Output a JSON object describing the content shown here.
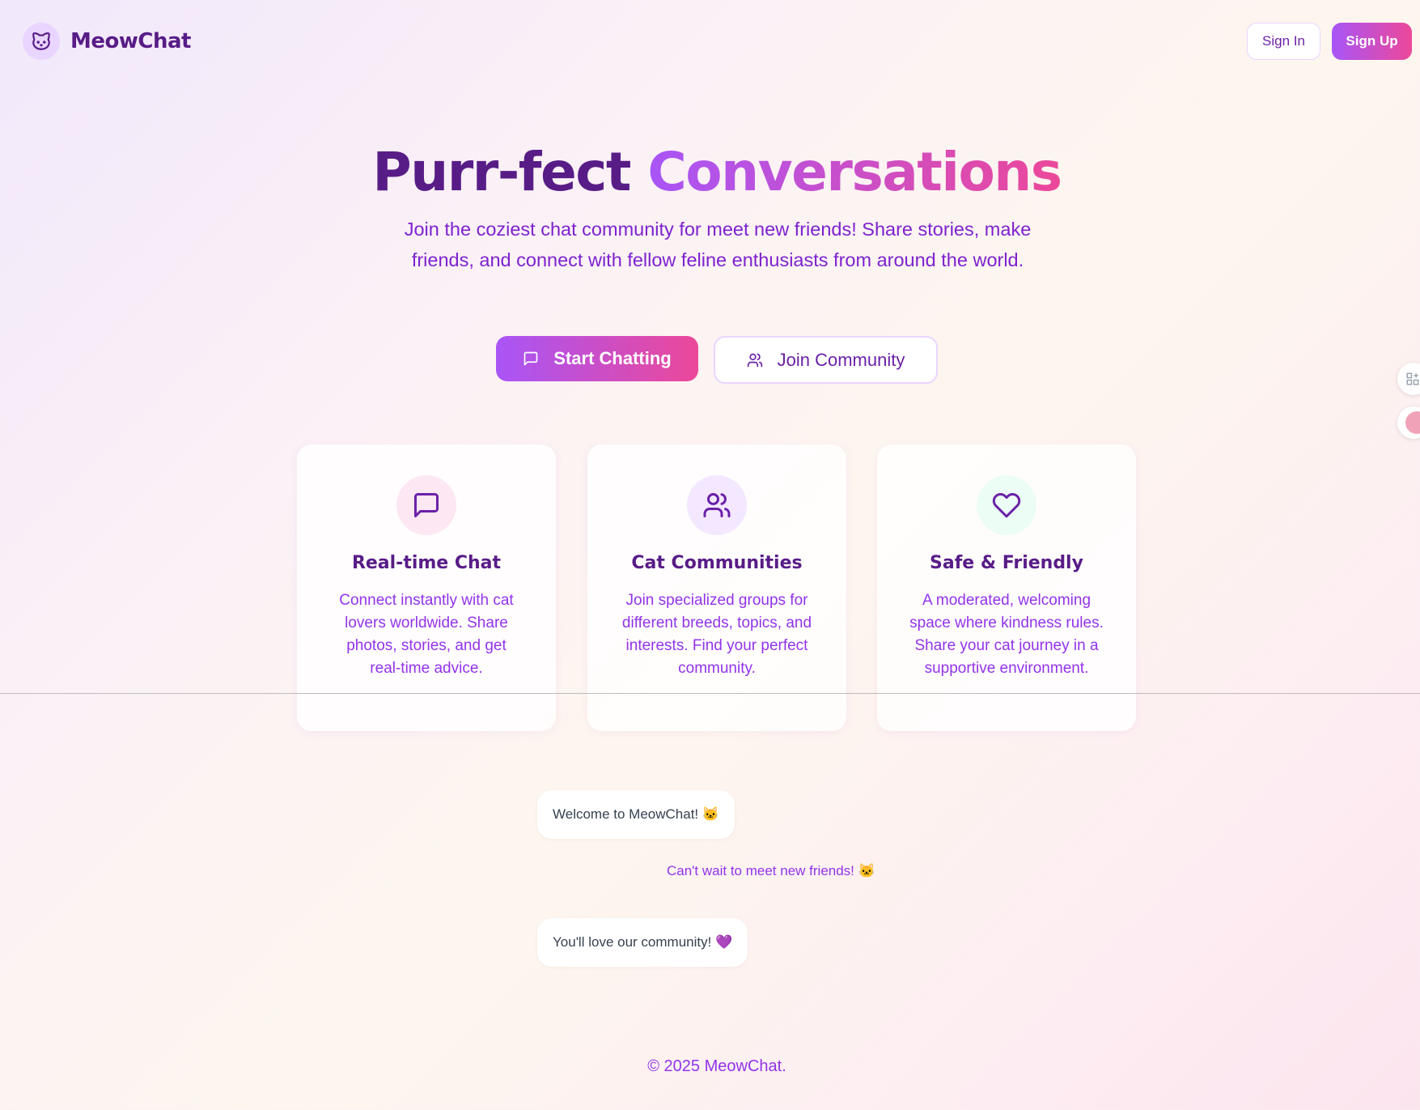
{
  "header": {
    "brand_name": "MeowChat",
    "logo_icon": "cat-icon",
    "signin_label": "Sign In",
    "signup_label": "Sign Up"
  },
  "hero": {
    "title_part1": "Purr-fect",
    "title_part2": "Conversations",
    "subtitle": "Join the coziest chat community for meet new friends! Share stories, make friends, and connect with fellow feline enthusiasts from around the world.",
    "start_label": "Start Chatting",
    "join_label": "Join Community"
  },
  "features": [
    {
      "icon": "message-square-icon",
      "title": "Real-time Chat",
      "desc": "Connect instantly with cat lovers worldwide. Share photos, stories, and get real-time advice.",
      "icon_bg": "#fce7f3"
    },
    {
      "icon": "users-icon",
      "title": "Cat Communities",
      "desc": "Join specialized groups for different breeds, topics, and interests. Find your perfect community.",
      "icon_bg": "#f3e8ff"
    },
    {
      "icon": "heart-icon",
      "title": "Safe & Friendly",
      "desc": "A moderated, welcoming space where kindness rules. Share your cat journey in a supportive environment.",
      "icon_bg": "#ecfdf5"
    }
  ],
  "chat_preview": {
    "msg1": "Welcome to MeowChat! 🐱",
    "msg2": "Can't wait to meet new friends! 🐱",
    "msg3": "You'll love our community! 💜"
  },
  "footer": {
    "text": "© 2025 MeowChat."
  },
  "colors": {
    "primary_dark": "#581c87",
    "primary": "#a855f7",
    "accent": "#ec4899"
  }
}
